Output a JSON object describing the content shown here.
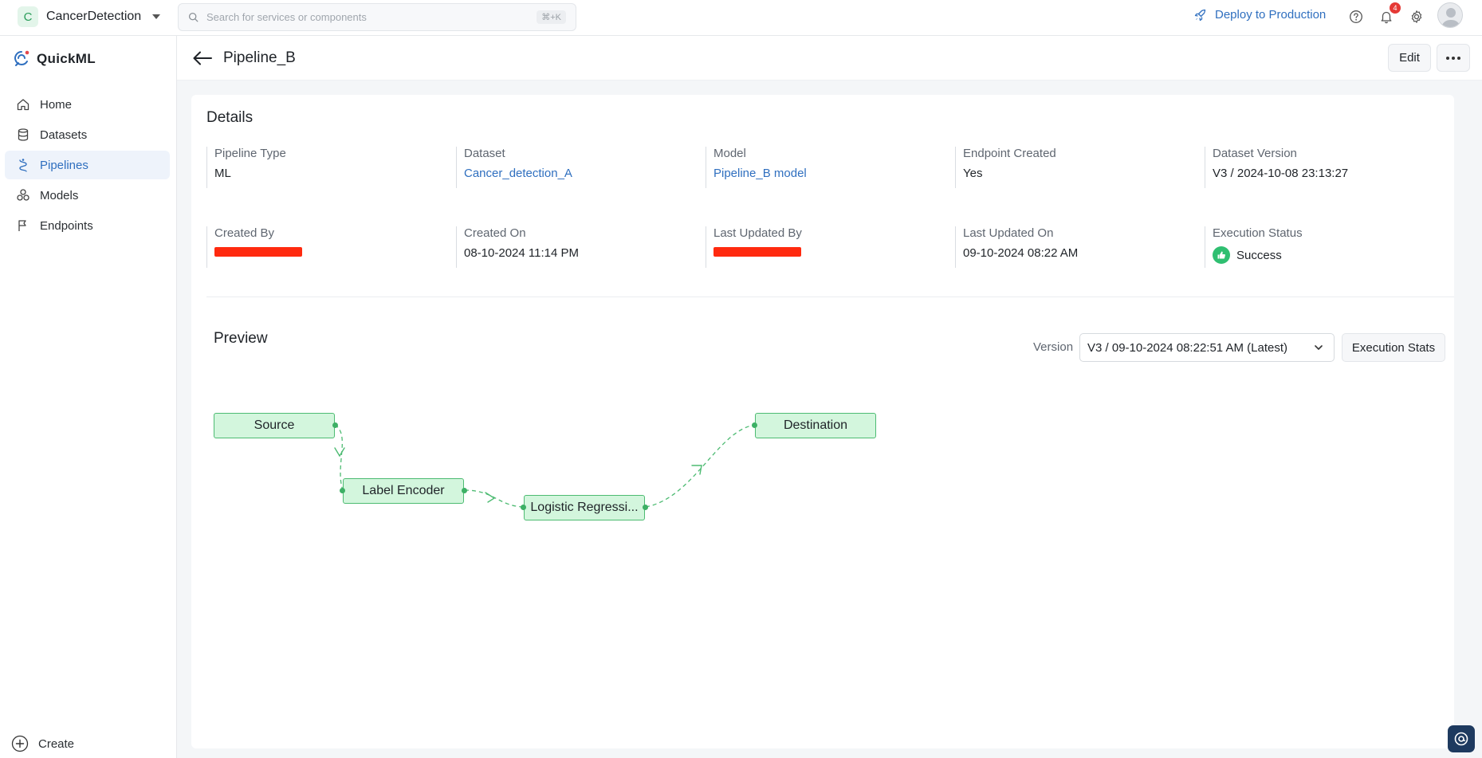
{
  "topbar": {
    "project_initial": "C",
    "project_name": "CancerDetection",
    "search_placeholder": "Search for services or components",
    "search_shortcut": "⌘+K",
    "deploy_label": "Deploy to Production",
    "notification_count": "4"
  },
  "sidebar": {
    "brand": "QuickML",
    "items": [
      {
        "label": "Home",
        "icon": "home-icon"
      },
      {
        "label": "Datasets",
        "icon": "database-icon"
      },
      {
        "label": "Pipelines",
        "icon": "pipeline-icon",
        "active": true
      },
      {
        "label": "Models",
        "icon": "models-icon"
      },
      {
        "label": "Endpoints",
        "icon": "endpoint-flag-icon"
      }
    ],
    "create_label": "Create"
  },
  "header": {
    "title": "Pipeline_B",
    "edit_label": "Edit"
  },
  "details": {
    "title": "Details",
    "pipeline_type_label": "Pipeline Type",
    "pipeline_type": "ML",
    "dataset_label": "Dataset",
    "dataset": "Cancer_detection_A",
    "model_label": "Model",
    "model": "Pipeline_B model",
    "endpoint_created_label": "Endpoint Created",
    "endpoint_created": "Yes",
    "dataset_version_label": "Dataset Version",
    "dataset_version": "V3 / 2024-10-08 23:13:27",
    "created_by_label": "Created By",
    "created_on_label": "Created On",
    "created_on": "08-10-2024 11:14 PM",
    "last_updated_by_label": "Last Updated By",
    "last_updated_on_label": "Last Updated On",
    "last_updated_on": "09-10-2024 08:22 AM",
    "execution_status_label": "Execution Status",
    "execution_status": "Success"
  },
  "preview": {
    "title": "Preview",
    "version_label": "Version",
    "version_value": "V3 / 09-10-2024 08:22:51 AM (Latest)",
    "exec_stats_label": "Execution Stats",
    "nodes": {
      "source": "Source",
      "label_encoder": "Label Encoder",
      "logistic_regression": "Logistic Regressi...",
      "destination": "Destination"
    }
  },
  "colors": {
    "accent": "#2f6fbf",
    "node_fill": "#d3f6dd",
    "node_border": "#4dbb72",
    "success": "#2fbf71",
    "redaction": "#ff2a0f"
  }
}
